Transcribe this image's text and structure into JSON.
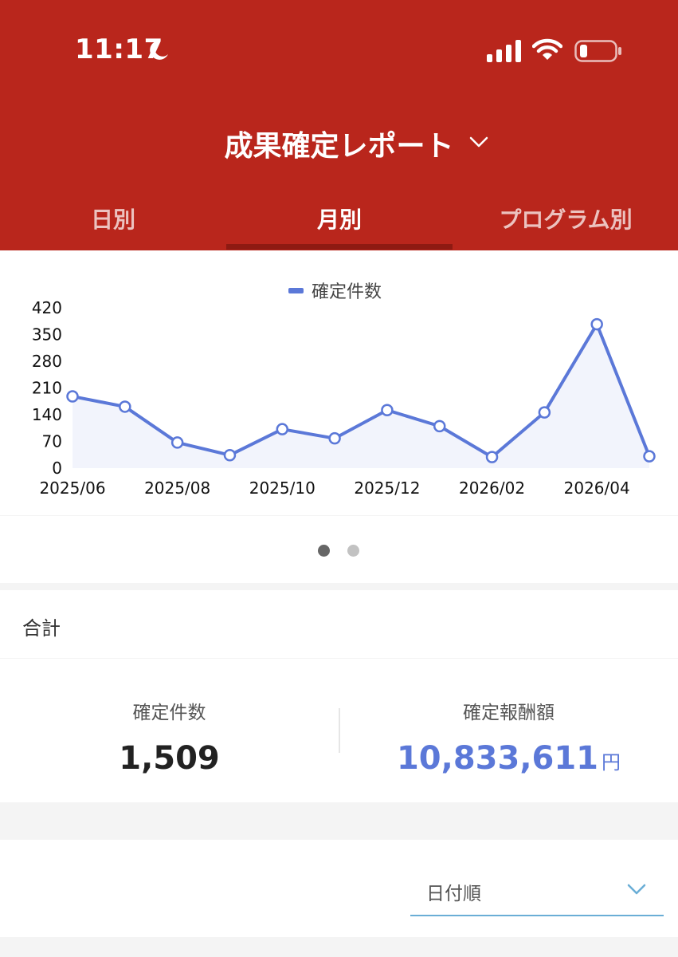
{
  "status_bar": {
    "time": "11:17"
  },
  "header": {
    "title": "成果確定レポート"
  },
  "tabs": [
    {
      "label": "日別",
      "active": false
    },
    {
      "label": "月別",
      "active": true
    },
    {
      "label": "プログラム別",
      "active": false
    }
  ],
  "chart_data": {
    "type": "line",
    "legend": "確定件数",
    "series": [
      {
        "name": "確定件数",
        "color": "#5b78d8",
        "x": [
          "2025/06",
          "2025/07",
          "2025/08",
          "2025/09",
          "2025/10",
          "2025/11",
          "2025/12",
          "2026/01",
          "2026/02",
          "2026/03",
          "2026/04",
          "2026/05"
        ],
        "values": [
          188,
          161,
          67,
          34,
          102,
          78,
          152,
          110,
          29,
          146,
          377,
          31
        ]
      }
    ],
    "x_tick_labels": [
      "2025/06",
      "2025/08",
      "2025/10",
      "2025/12",
      "2026/02",
      "2026/04"
    ],
    "y_ticks": [
      0,
      70,
      140,
      210,
      280,
      350,
      420
    ],
    "ylim": [
      0,
      420
    ]
  },
  "pager": {
    "count": 2,
    "active_index": 0
  },
  "totals": {
    "section_label": "合計",
    "count_label": "確定件数",
    "count_value": "1,509",
    "reward_label": "確定報酬額",
    "reward_value": "10,833,611",
    "reward_unit": "円"
  },
  "sort": {
    "selected": "日付順"
  }
}
